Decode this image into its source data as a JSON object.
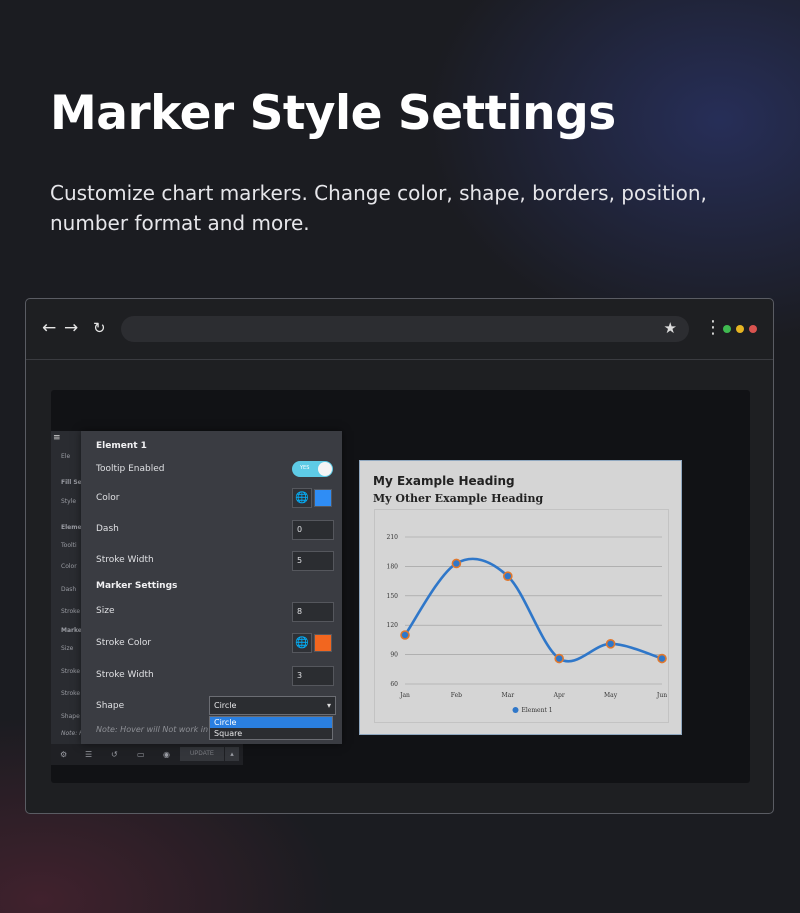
{
  "hero": {
    "title": "Marker Style Settings",
    "subtitle": "Customize chart markers. Change color, shape, borders, position, number format and more."
  },
  "browser": {
    "nav_icons": [
      "back-arrow-icon",
      "forward-arrow-icon",
      "reload-icon"
    ],
    "star_icon": "star-icon",
    "menu_icon": "kebab-menu-icon",
    "dot_colors": [
      "#3fb950",
      "#e6b422",
      "#d9534f"
    ]
  },
  "editor": {
    "sidebar_rows": [
      "Ele",
      "Fill Set",
      "Style",
      "Eleme",
      "Toolti",
      "Color",
      "Dash",
      "Stroke",
      "Marke",
      "Size",
      "Stroke",
      "Stroke",
      "Shape",
      "Note: H"
    ],
    "footer": {
      "update_label": "UPDATE"
    },
    "panel": {
      "section_title": "Element 1",
      "tooltip_label": "Tooltip Enabled",
      "tooltip_toggle_text": "YES",
      "color_label": "Color",
      "color_value": "#2f8df5",
      "dash_label": "Dash",
      "dash_value": "0",
      "stroke_width_label": "Stroke Width",
      "stroke_width_value": "5",
      "marker_title": "Marker Settings",
      "size_label": "Size",
      "size_value": "8",
      "stroke_color_label": "Stroke Color",
      "stroke_color_value": "#f2661f",
      "marker_stroke_width_label": "Stroke Width",
      "marker_stroke_width_value": "3",
      "shape_label": "Shape",
      "shape_value": "Circle",
      "shape_options": [
        "Circle",
        "Square"
      ],
      "note": "Note: Hover will Not work in Sc"
    }
  },
  "preview": {
    "heading": "My Example Heading",
    "subheading": "My Other Example Heading"
  },
  "chart_data": {
    "type": "line",
    "title": "",
    "categories": [
      "Jan",
      "Feb",
      "Mar",
      "Apr",
      "May",
      "Jun"
    ],
    "series": [
      {
        "name": "Element 1",
        "values": [
          110,
          183,
          170,
          86,
          101,
          86
        ],
        "color": "#2f77c9",
        "marker_stroke": "#e0782e"
      }
    ],
    "yticks": [
      60,
      90,
      120,
      150,
      180,
      210
    ],
    "ylim": [
      60,
      210
    ],
    "grid": true,
    "curve": "smooth",
    "legend": "bottom"
  }
}
